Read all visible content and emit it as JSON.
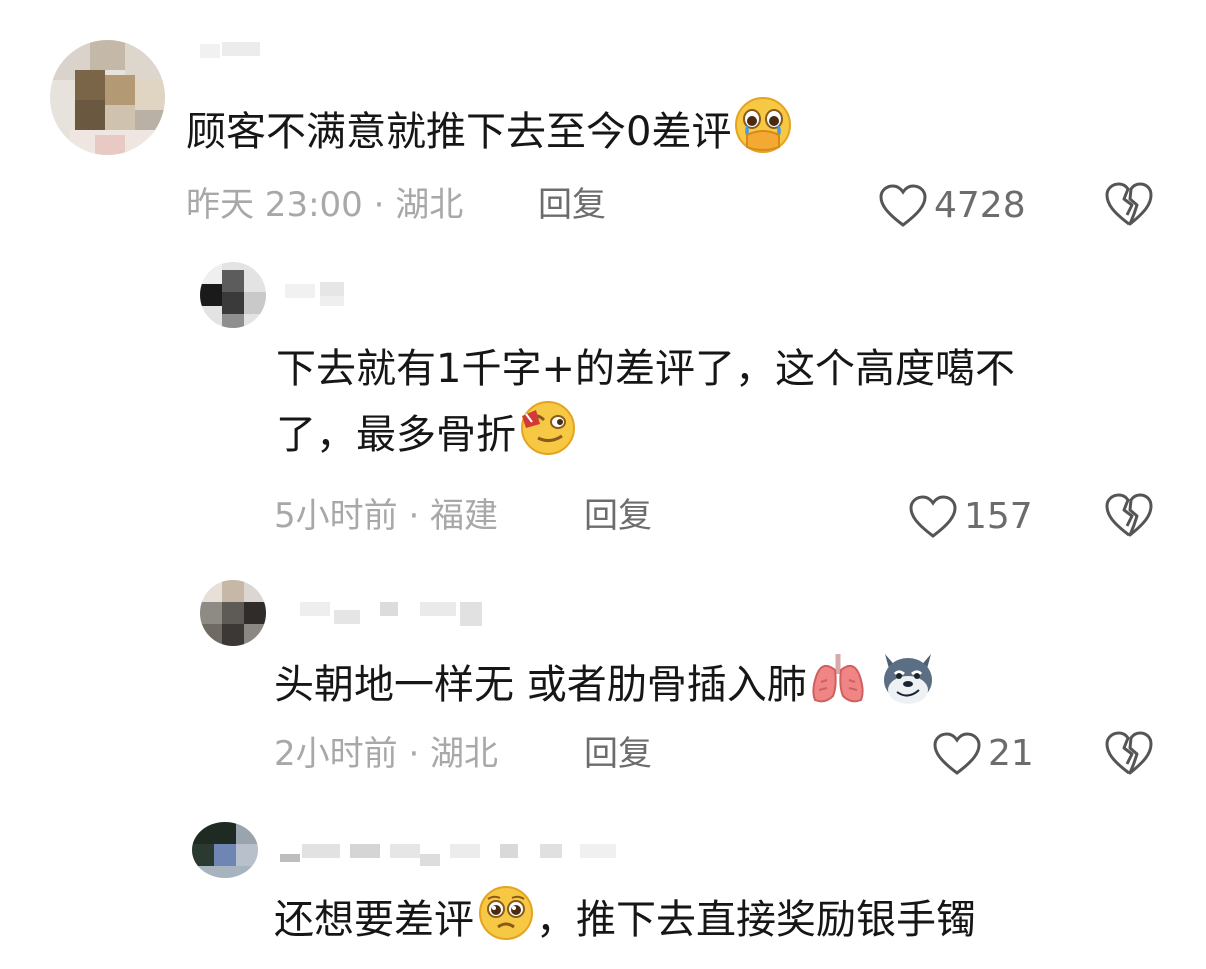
{
  "comments": [
    {
      "text": "顾客不满意就推下去至今0差评",
      "emoji": "crying-hands-over-mouth-emoji",
      "time_location": "昨天 23:00 · 湖北",
      "reply_label": "回复",
      "likes": "4728"
    },
    {
      "text_line1": "下去就有1千字+的差评了，这个高度噶不",
      "text_line2": "了，最多骨折",
      "emoji": "smirk-with-tongue-emoji",
      "time_location": "5小时前 · 福建",
      "reply_label": "回复",
      "likes": "157"
    },
    {
      "text": "头朝地一样无  或者肋骨插入肺",
      "emoji": "lungs-emoji",
      "emoji2": "dog-face-emoji",
      "time_location": "2小时前 · 湖北",
      "reply_label": "回复",
      "likes": "21"
    },
    {
      "text_a": "还想要差评",
      "emoji": "pleading-face-emoji",
      "text_b": "，推下去直接奖励银手镯"
    }
  ],
  "colors": {
    "text": "#161616",
    "meta_gray": "#a8a8a8",
    "action_gray": "#6c6c6c"
  }
}
